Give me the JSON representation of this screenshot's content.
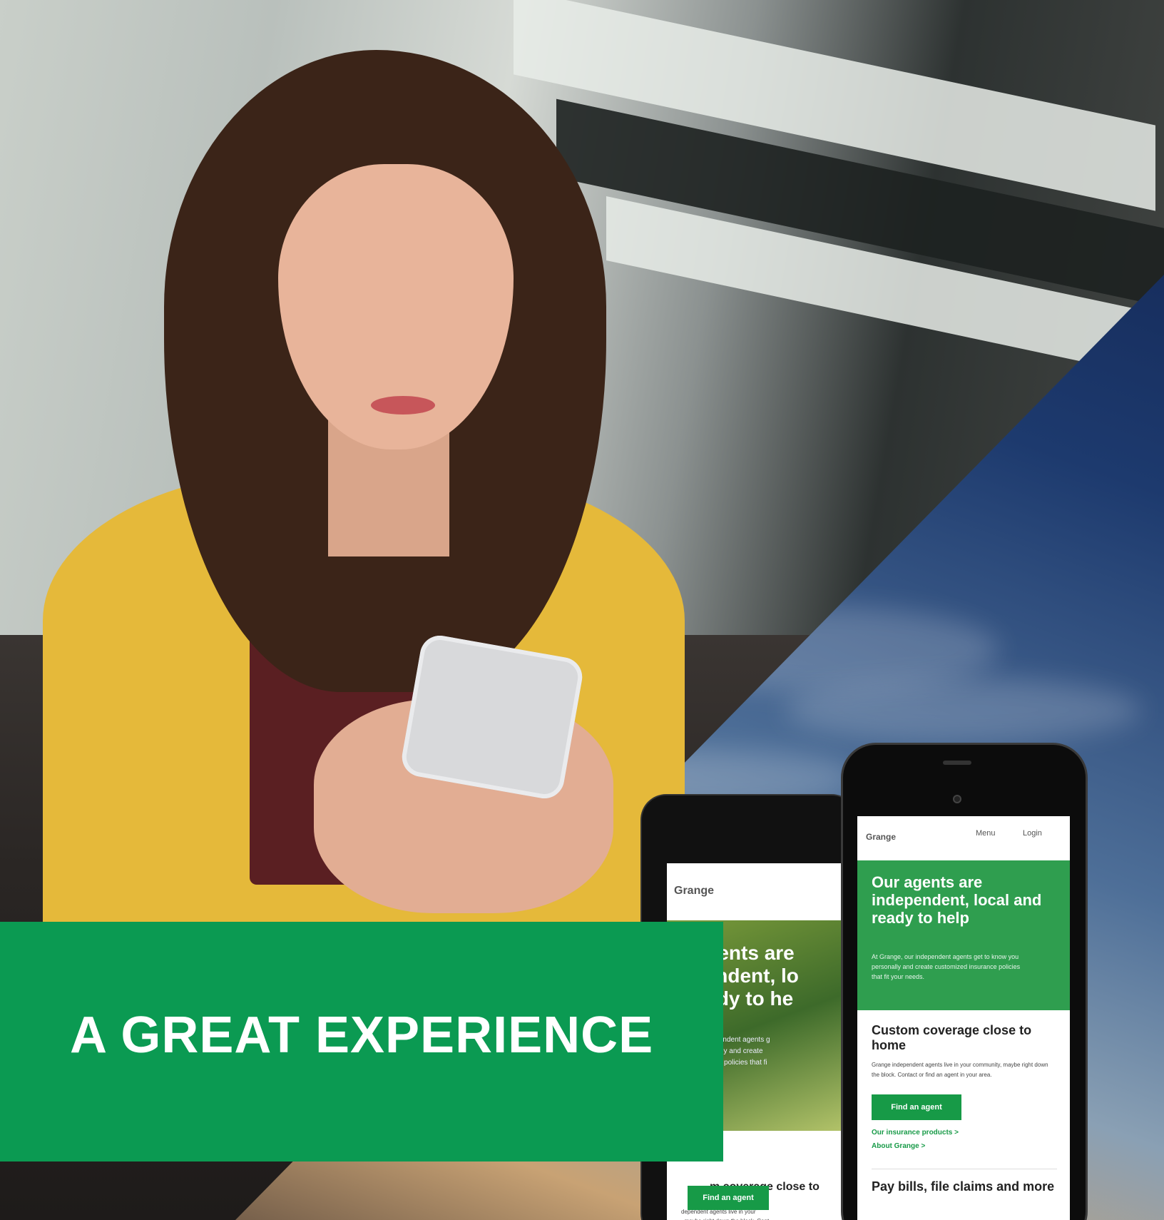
{
  "banner": {
    "headline": "A GREAT EXPERIENCE"
  },
  "phone": {
    "logo": "Grange",
    "nav": [
      "Menu",
      "Login"
    ],
    "hero_title": "Our agents are independent, local and ready to help",
    "hero_text": "At Grange, our independent agents get to know you personally and create customized insurance policies that fit your needs.",
    "section_title": "Custom coverage close to home",
    "section_text": "Grange independent agents live in your community, maybe right down the block. Contact or find an agent in your area.",
    "button": "Find an agent",
    "links": [
      "Our insurance products >",
      "About Grange >"
    ],
    "section2_title": "Pay bills, file claims and more"
  },
  "tablet": {
    "logo": "Grange",
    "hero_title": "r agents are\nependent, lo\n ready to he",
    "hero_text": "e, our independent agents g\nyou personally and create\ned insurance policies that fi\nds.",
    "section_title": "m coverage close to",
    "section_text": "dependent agents live in your\n, maybe right down the block. Cont\nor find an agent in your area.",
    "button": "Find an agent"
  },
  "colors": {
    "brand_green": "#0b9a52",
    "phone_green": "#2f9e4f"
  }
}
